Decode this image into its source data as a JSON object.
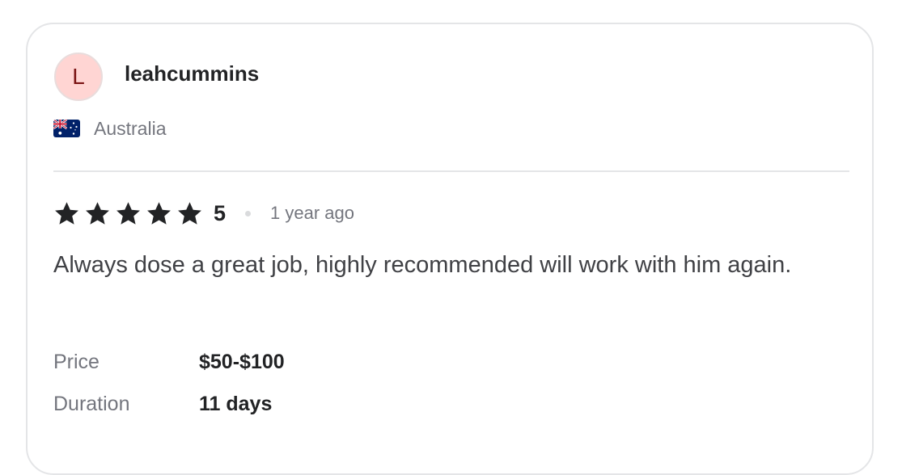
{
  "review": {
    "avatar_initial": "L",
    "username": "leahcummins",
    "country": "Australia",
    "country_flag_icon": "australia-flag-icon",
    "rating_value": "5",
    "star_count": 5,
    "time_ago": "1 year ago",
    "text": "Always dose a great job, highly recommended will work with him again.",
    "details": [
      {
        "label": "Price",
        "value": "$50-$100"
      },
      {
        "label": "Duration",
        "value": "11 days"
      }
    ]
  },
  "colors": {
    "avatar_bg": "#ffd5d3",
    "avatar_text": "#7a1414",
    "star": "#222325",
    "muted_text": "#74767e",
    "border": "#e4e5e7"
  }
}
